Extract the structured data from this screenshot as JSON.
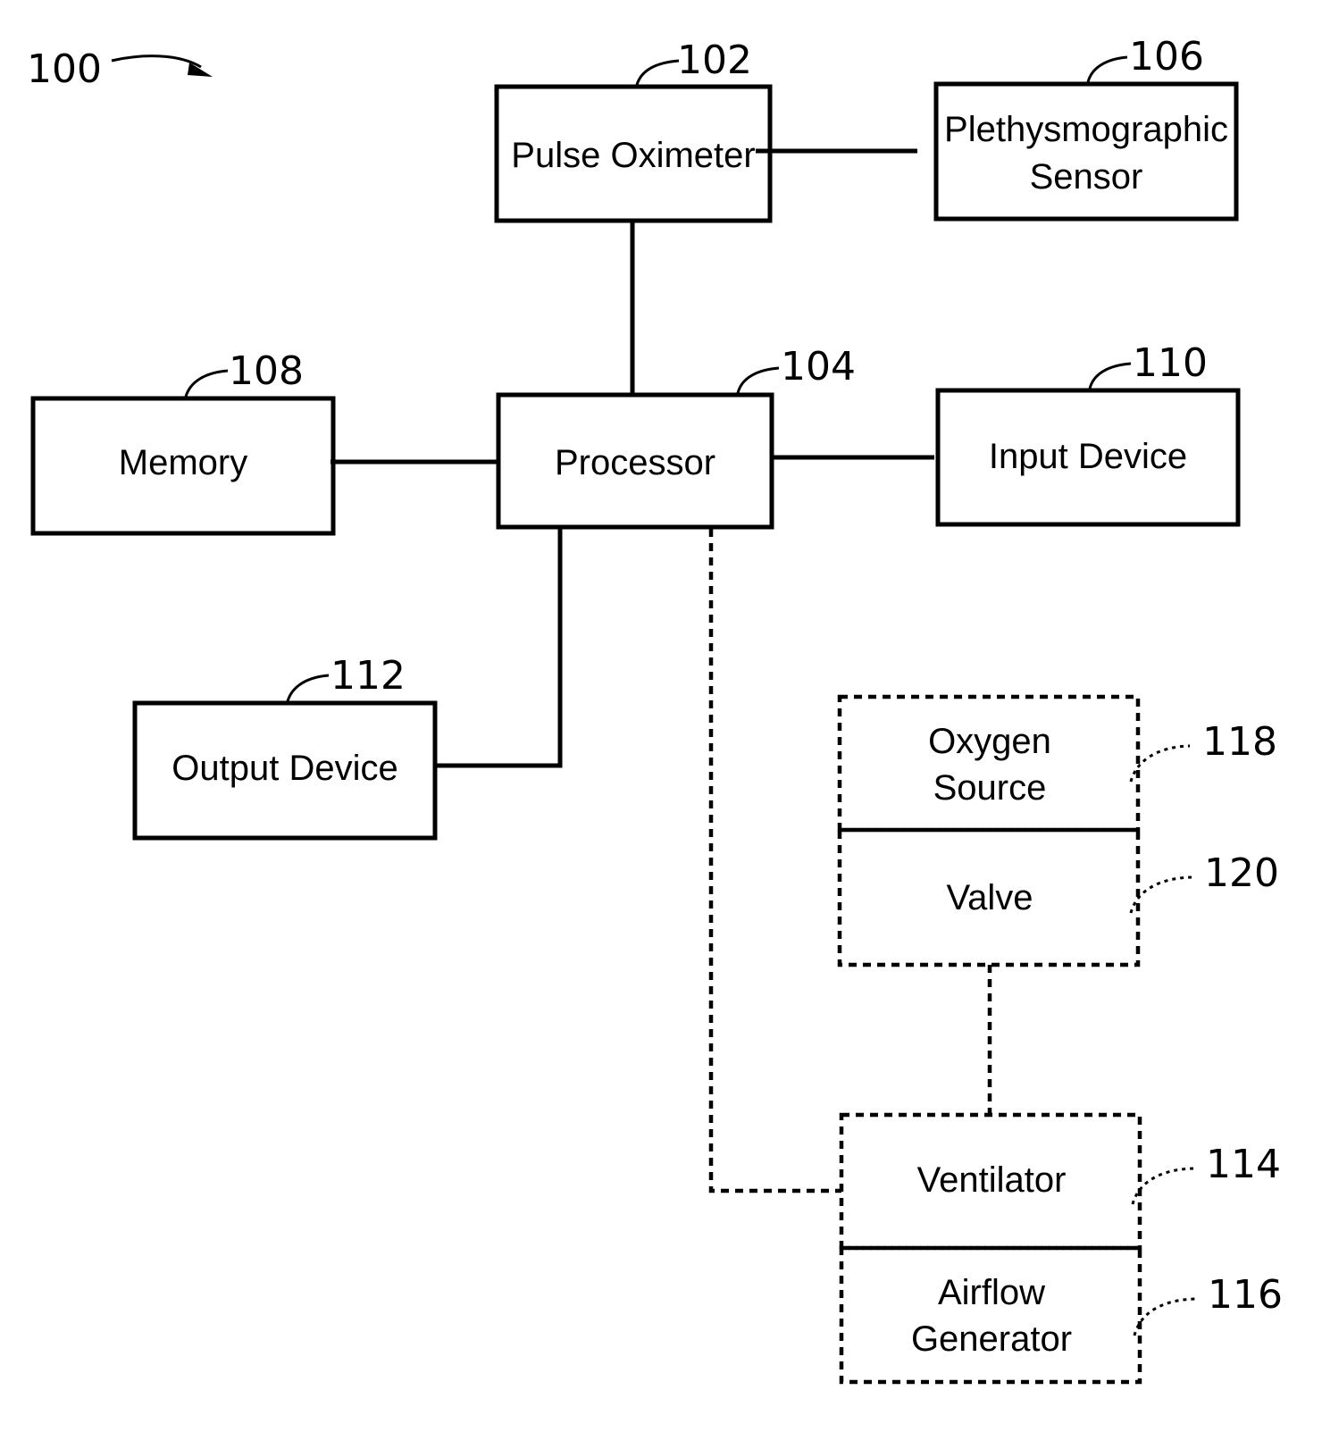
{
  "figure": {
    "ref": "100",
    "blocks": [
      {
        "id": "pulse_oximeter",
        "ref": "102",
        "lines": [
          "Pulse Oximeter"
        ],
        "style": "solid"
      },
      {
        "id": "plethysmographic_sensor",
        "ref": "106",
        "lines": [
          "Plethysmographic",
          "Sensor"
        ],
        "style": "solid"
      },
      {
        "id": "memory",
        "ref": "108",
        "lines": [
          "Memory"
        ],
        "style": "solid"
      },
      {
        "id": "processor",
        "ref": "104",
        "lines": [
          "Processor"
        ],
        "style": "solid"
      },
      {
        "id": "input_device",
        "ref": "110",
        "lines": [
          "Input Device"
        ],
        "style": "solid"
      },
      {
        "id": "output_device",
        "ref": "112",
        "lines": [
          "Output Device"
        ],
        "style": "solid"
      },
      {
        "id": "oxygen_source",
        "ref": "118",
        "lines": [
          "Oxygen",
          "Source"
        ],
        "style": "dashed"
      },
      {
        "id": "valve",
        "ref": "120",
        "lines": [
          "Valve"
        ],
        "style": "dashed"
      },
      {
        "id": "ventilator",
        "ref": "114",
        "lines": [
          "Ventilator"
        ],
        "style": "dashed"
      },
      {
        "id": "airflow_generator",
        "ref": "116",
        "lines": [
          "Airflow",
          "Generator"
        ],
        "style": "dashed"
      }
    ],
    "connections": [
      {
        "from": "pulse_oximeter",
        "to": "plethysmographic_sensor",
        "style": "solid"
      },
      {
        "from": "pulse_oximeter",
        "to": "processor",
        "style": "solid"
      },
      {
        "from": "memory",
        "to": "processor",
        "style": "solid"
      },
      {
        "from": "processor",
        "to": "input_device",
        "style": "solid"
      },
      {
        "from": "processor",
        "to": "output_device",
        "style": "solid"
      },
      {
        "from": "processor",
        "to": "ventilator",
        "style": "dashed"
      },
      {
        "from": "valve",
        "to": "ventilator",
        "style": "dashed"
      }
    ]
  }
}
